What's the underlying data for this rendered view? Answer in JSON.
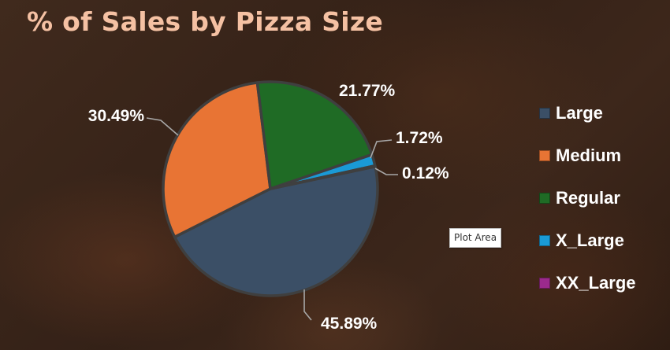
{
  "chart_data": {
    "type": "pie",
    "title": "% of Sales by Pizza Size",
    "categories": [
      "Large",
      "Medium",
      "Regular",
      "X_Large",
      "XX_Large"
    ],
    "values": [
      45.89,
      30.49,
      21.77,
      1.72,
      0.12
    ],
    "data_labels": [
      "45.89%",
      "30.49%",
      "21.77%",
      "1.72%",
      "0.12%"
    ],
    "colors": [
      "#3b4f66",
      "#e87434",
      "#1f6b25",
      "#1a9ad6",
      "#9b2a8c"
    ],
    "legend_position": "right",
    "unit": "%"
  },
  "theme": {
    "title_color": "#f5c1a3",
    "label_color": "#ffffff",
    "slice_border": "#3f3f3f"
  },
  "tooltip": {
    "text": "Plot Area"
  }
}
